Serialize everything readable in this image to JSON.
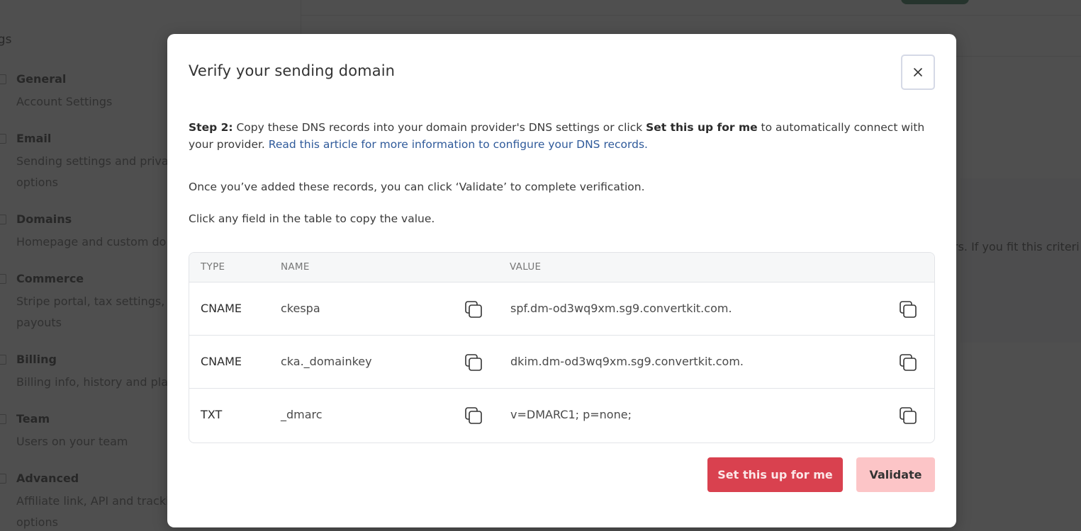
{
  "background": {
    "sidebar": {
      "section_title": "ngs",
      "items": [
        {
          "title": "General",
          "desc": "Account Settings"
        },
        {
          "title": "Email",
          "desc": "Sending settings and privacy options"
        },
        {
          "title": "Domains",
          "desc": "Homepage and custom domains"
        },
        {
          "title": "Commerce",
          "desc": "Stripe portal, tax settings, and payouts"
        },
        {
          "title": "Billing",
          "desc": "Billing info, history and plans"
        },
        {
          "title": "Team",
          "desc": "Users on your team"
        },
        {
          "title": "Advanced",
          "desc": "Affiliate link, API and tracking options"
        }
      ]
    },
    "panel_text": "rs. If you fit this criteri"
  },
  "modal": {
    "title": "Verify your sending domain",
    "close_label": "Close",
    "step_label": "Step 2:",
    "step_text_1": " Copy these DNS records into your domain provider's DNS settings or click ",
    "step_bold": "Set this up for me",
    "step_text_2": " to automatically connect with your provider. ",
    "article_link": "Read this article for more information to configure your DNS records.",
    "validate_hint": "Once you’ve added these records, you can click ‘Validate’ to complete verification.",
    "copy_hint": "Click any field in the table to copy the value.",
    "table": {
      "headers": {
        "type": "TYPE",
        "name": "NAME",
        "value": "VALUE"
      },
      "rows": [
        {
          "type": "CNAME",
          "name": "ckespa",
          "value": "spf.dm-od3wq9xm.sg9.convertkit.com."
        },
        {
          "type": "CNAME",
          "name": "cka._domainkey",
          "value": "dkim.dm-od3wq9xm.sg9.convertkit.com."
        },
        {
          "type": "TXT",
          "name": "_dmarc",
          "value": "v=DMARC1; p=none;"
        }
      ]
    },
    "buttons": {
      "setup": "Set this up for me",
      "validate": "Validate"
    }
  },
  "colors": {
    "primary_red": "#d9414f",
    "validate_pink": "#fcc5c7",
    "link_blue": "#2f5a9a"
  }
}
